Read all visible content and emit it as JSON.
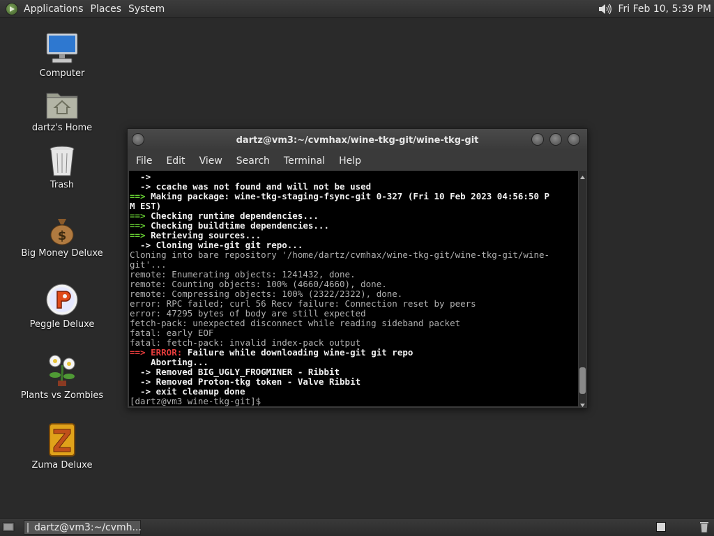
{
  "top_panel": {
    "menus": [
      "Applications",
      "Places",
      "System"
    ],
    "clock": "Fri Feb 10,  5:39 PM",
    "icons": {
      "menu": "gnome-foot-icon",
      "volume": "speaker-icon"
    }
  },
  "desktop_icons": [
    {
      "label": "Computer",
      "icon": "computer-icon"
    },
    {
      "label": "dartz's Home",
      "icon": "home-folder-icon"
    },
    {
      "label": "Trash",
      "icon": "trash-icon"
    },
    {
      "label": "Big Money Deluxe",
      "icon": "money-bag-icon"
    },
    {
      "label": "Peggle Deluxe",
      "icon": "peggle-icon"
    },
    {
      "label": "Plants vs Zombies",
      "icon": "plants-icon"
    },
    {
      "label": "Zuma Deluxe",
      "icon": "zuma-icon"
    }
  ],
  "terminal": {
    "title": "dartz@vm3:~/cvmhax/wine-tkg-git/wine-tkg-git",
    "menu": [
      "File",
      "Edit",
      "View",
      "Search",
      "Terminal",
      "Help"
    ],
    "lines": [
      [
        {
          "t": "  ->",
          "c": "w"
        }
      ],
      [
        {
          "t": "  -> ccache was not found and will not be used",
          "c": "w"
        }
      ],
      [
        {
          "t": "==>",
          "c": "g"
        },
        {
          "t": " Making package: wine-tkg-staging-fsync-git 0-327 (Fri 10 Feb 2023 04:56:50 P",
          "c": "w"
        }
      ],
      [
        {
          "t": "M EST)",
          "c": "w"
        }
      ],
      [
        {
          "t": "==>",
          "c": "g"
        },
        {
          "t": " Checking runtime dependencies...",
          "c": "w"
        }
      ],
      [
        {
          "t": "==>",
          "c": "g"
        },
        {
          "t": " Checking buildtime dependencies...",
          "c": "w"
        }
      ],
      [
        {
          "t": "==>",
          "c": "g"
        },
        {
          "t": " Retrieving sources...",
          "c": "w"
        }
      ],
      [
        {
          "t": "  -> Cloning wine-git git repo...",
          "c": "w"
        }
      ],
      [
        {
          "t": "Cloning into bare repository '/home/dartz/cvmhax/wine-tkg-git/wine-tkg-git/wine-",
          "c": "n"
        }
      ],
      [
        {
          "t": "git'...",
          "c": "n"
        }
      ],
      [
        {
          "t": "remote: Enumerating objects: 1241432, done.",
          "c": "n"
        }
      ],
      [
        {
          "t": "remote: Counting objects: 100% (4660/4660), done.",
          "c": "n"
        }
      ],
      [
        {
          "t": "remote: Compressing objects: 100% (2322/2322), done.",
          "c": "n"
        }
      ],
      [
        {
          "t": "error: RPC failed; curl 56 Recv failure: Connection reset by peers",
          "c": "n"
        }
      ],
      [
        {
          "t": "error: 47295 bytes of body are still expected",
          "c": "n"
        }
      ],
      [
        {
          "t": "fetch-pack: unexpected disconnect while reading sideband packet",
          "c": "n"
        }
      ],
      [
        {
          "t": "fatal: early EOF",
          "c": "n"
        }
      ],
      [
        {
          "t": "fatal: fetch-pack: invalid index-pack output",
          "c": "n"
        }
      ],
      [
        {
          "t": "==>",
          "c": "r"
        },
        {
          "t": " ERROR:",
          "c": "r"
        },
        {
          "t": " Failure while downloading wine-git git repo",
          "c": "w"
        }
      ],
      [
        {
          "t": "    Aborting...",
          "c": "w"
        }
      ],
      [
        {
          "t": "  -> Removed BIG_UGLY_FROGMINER - Ribbit",
          "c": "w"
        }
      ],
      [
        {
          "t": "  -> Removed Proton-tkg token - Valve Ribbit",
          "c": "w"
        }
      ],
      [
        {
          "t": "  -> exit cleanup done",
          "c": "w"
        }
      ],
      [
        {
          "t": "[dartz@vm3 wine-tkg-git]$ ",
          "c": "n"
        }
      ]
    ]
  },
  "taskbar": {
    "task_label": "dartz@vm3:~/cvmh..."
  },
  "colors": {
    "prompt_green": "#66cc33",
    "error_red": "#e63c3c",
    "desktop_bg": "#2a2a2a"
  }
}
